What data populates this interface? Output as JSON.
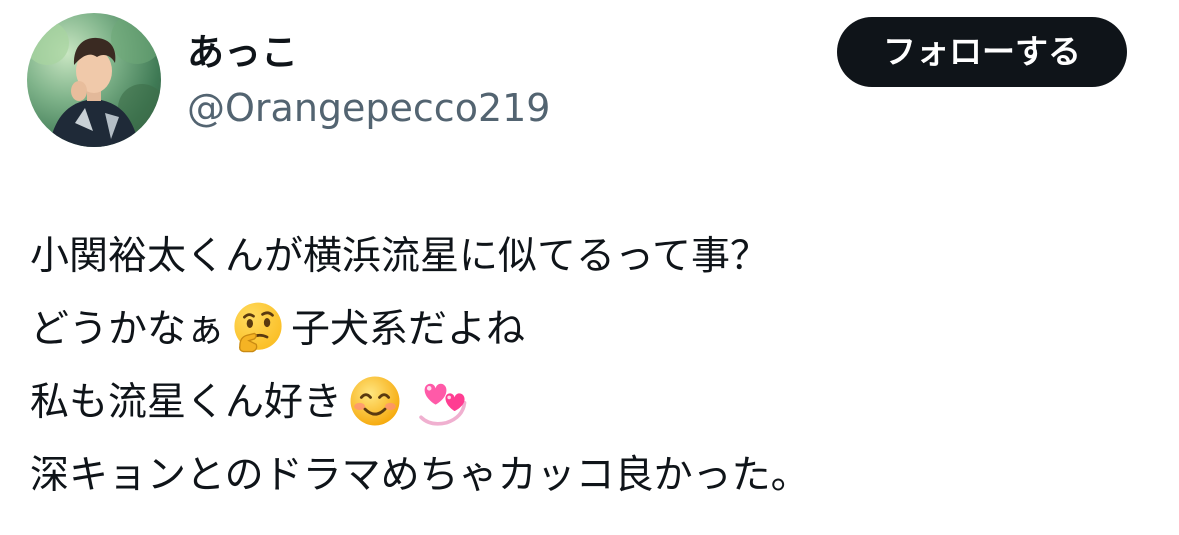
{
  "user": {
    "display_name": "あっこ",
    "handle": "@Orangepecco219",
    "avatar_icon": "profile-photo-icon"
  },
  "follow_button": {
    "label": "フォローする"
  },
  "tweet": {
    "line1": "小関裕太くんが横浜流星に似てるって事？",
    "line2_before_emoji": "どうかなぁ",
    "line2_after_emoji": "子犬系だよね",
    "line3_before_emoji": "私も流星くん好き",
    "line4": "深キョンとのドラマめちゃカッコ良かった。",
    "emojis": [
      "thinking-face-emoji",
      "smiling-face-emoji",
      "revolving-hearts-emoji"
    ]
  },
  "colors": {
    "text": "#0f1419",
    "secondary_text": "#536471",
    "button_bg": "#0f1419",
    "button_text": "#ffffff"
  }
}
